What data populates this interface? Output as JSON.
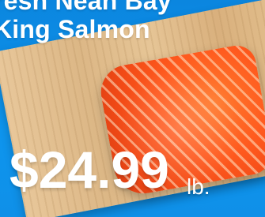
{
  "headline": {
    "line1": "resh Neah Bay",
    "line2": "King Salmon"
  },
  "price": {
    "amount": "$24.99",
    "unit": "lb."
  },
  "colors": {
    "background": "#0d8fe6",
    "board": "#e1bd8b",
    "salmon": "#ff5a1e",
    "text": "#ffffff"
  }
}
